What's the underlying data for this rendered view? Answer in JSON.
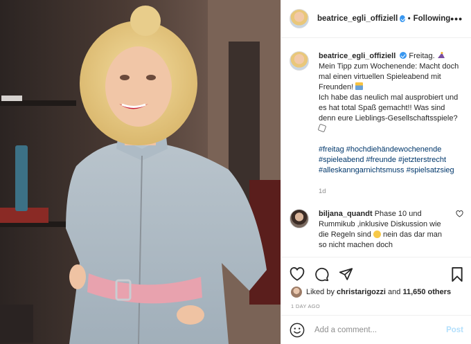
{
  "header": {
    "username": "beatrice_egli_offiziell",
    "separator": "•",
    "follow_label": "Following",
    "more_label": "•••"
  },
  "caption": {
    "username": "beatrice_egli_offiziell",
    "line1": "Freitag.",
    "line2": "Mein Tipp zum Wochenende: Macht doch mal einen virtuellen Spieleabend mit Freunden!",
    "line3": "Ich habe das neulich mal ausprobiert und es hat total Spaß gemacht!! Was sind denn eure Lieblings-Gesellschaftsspiele?",
    "hashtags": [
      "#freitag",
      "#hochdiehändewochenende",
      "#spieleabend",
      "#freunde",
      "#jetzterstrecht",
      "#alleskanngarnichtsmuss",
      "#spielsatzsieg"
    ],
    "time": "1d"
  },
  "comment": {
    "username": "biljana_quandt",
    "text_a": "Phase 10 und Rummikub ,inklusive Diskussion wie die Regeln sind",
    "text_b": "nein das dar man so nicht machen doch"
  },
  "likes": {
    "prefix": "Liked by",
    "user": "christarigozzi",
    "and": "and",
    "count": "11,650 others"
  },
  "date": "1 DAY AGO",
  "add_comment": {
    "placeholder": "Add a comment...",
    "post_label": "Post"
  },
  "icons": [
    "heart-icon",
    "comment-icon",
    "share-icon",
    "bookmark-icon",
    "emoji-icon",
    "verified-icon"
  ]
}
